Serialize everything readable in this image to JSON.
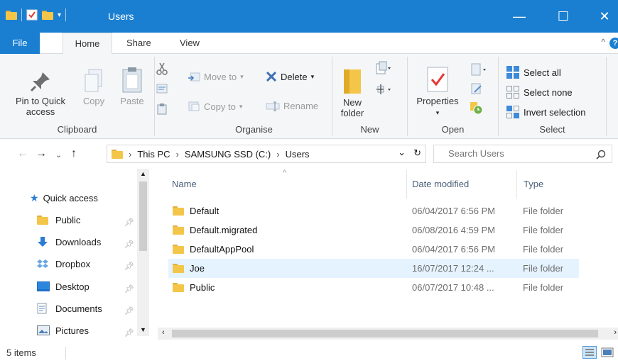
{
  "window": {
    "title": "Users",
    "minimize_glyph": "—",
    "maximize_glyph": "☐",
    "close_glyph": "✕"
  },
  "ribbon_tabs": {
    "file": "File",
    "home": "Home",
    "share": "Share",
    "view": "View"
  },
  "ribbon": {
    "clipboard": {
      "label": "Clipboard",
      "pin_line1": "Pin to Quick",
      "pin_line2": "access",
      "copy": "Copy",
      "paste": "Paste"
    },
    "organise": {
      "label": "Organise",
      "move_to": "Move to",
      "copy_to": "Copy to",
      "delete": "Delete",
      "rename": "Rename"
    },
    "new": {
      "label": "New",
      "new_folder_line1": "New",
      "new_folder_line2": "folder"
    },
    "open": {
      "label": "Open",
      "properties": "Properties"
    },
    "select": {
      "label": "Select",
      "select_all": "Select all",
      "select_none": "Select none",
      "invert_selection": "Invert selection"
    }
  },
  "address": {
    "crumbs": [
      "This PC",
      "SAMSUNG SSD (C:)",
      "Users"
    ],
    "search_placeholder": "Search Users"
  },
  "nav_pane": {
    "quick_access": "Quick access",
    "items": [
      {
        "label": "Public",
        "icon": "folder-icon"
      },
      {
        "label": "Downloads",
        "icon": "download-icon"
      },
      {
        "label": "Dropbox",
        "icon": "dropbox-icon"
      },
      {
        "label": "Desktop",
        "icon": "desktop-icon"
      },
      {
        "label": "Documents",
        "icon": "documents-icon"
      },
      {
        "label": "Pictures",
        "icon": "pictures-icon"
      }
    ]
  },
  "file_list": {
    "columns": {
      "name": "Name",
      "date": "Date modified",
      "type": "Type"
    },
    "rows": [
      {
        "name": "Default",
        "date": "06/04/2017 6:56 PM",
        "type": "File folder"
      },
      {
        "name": "Default.migrated",
        "date": "06/08/2016 4:59 PM",
        "type": "File folder"
      },
      {
        "name": "DefaultAppPool",
        "date": "06/04/2017 6:56 PM",
        "type": "File folder"
      },
      {
        "name": "Joe",
        "date": "16/07/2017 12:24 ...",
        "type": "File folder"
      },
      {
        "name": "Public",
        "date": "06/07/2017 10:48 ...",
        "type": "File folder"
      }
    ]
  },
  "status": {
    "item_count": "5 items"
  },
  "colors": {
    "accent": "#1a7fd1",
    "folder": "#f3c64a",
    "selection": "#e5f3ff"
  }
}
